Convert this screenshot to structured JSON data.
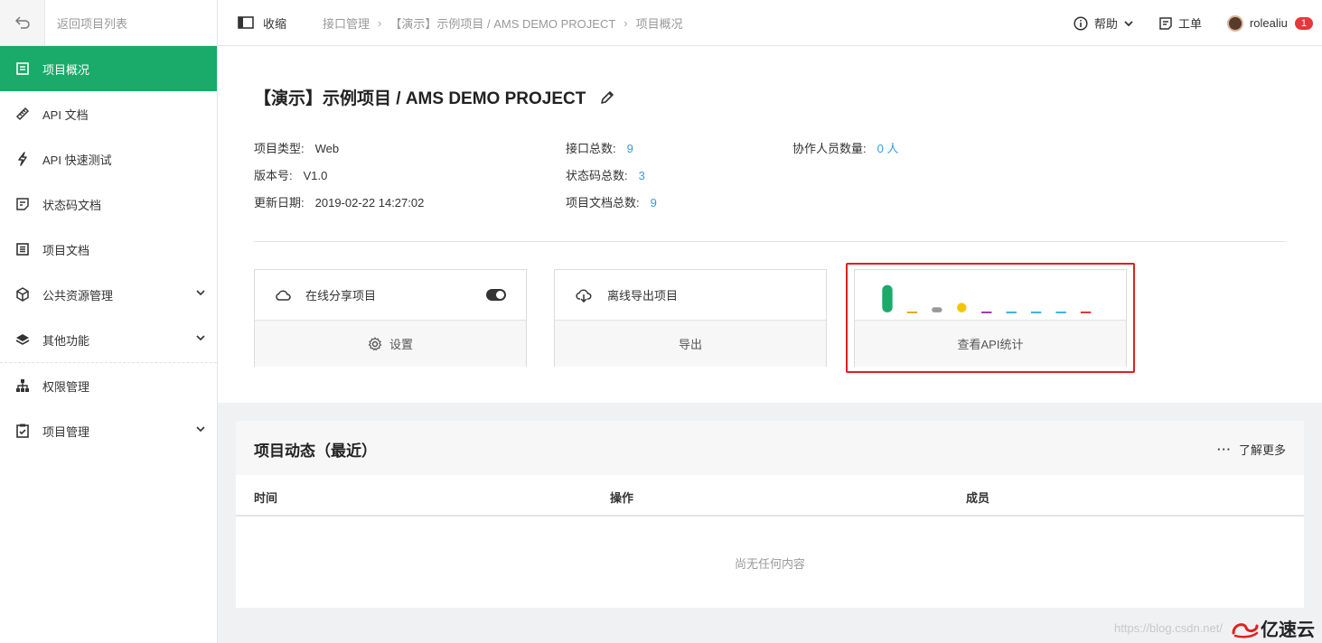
{
  "sidebar": {
    "back_label": "返回项目列表",
    "items": [
      {
        "label": "项目概况",
        "icon": "overview-icon",
        "active": true
      },
      {
        "label": "API 文档",
        "icon": "ruler-icon"
      },
      {
        "label": "API 快速测试",
        "icon": "lightning-icon"
      },
      {
        "label": "状态码文档",
        "icon": "code-doc-icon"
      },
      {
        "label": "项目文档",
        "icon": "document-icon"
      },
      {
        "label": "公共资源管理",
        "icon": "cube-icon",
        "expandable": true
      },
      {
        "label": "其他功能",
        "icon": "layers-icon",
        "expandable": true
      },
      {
        "label": "权限管理",
        "icon": "hierarchy-icon"
      },
      {
        "label": "项目管理",
        "icon": "clipboard-check-icon",
        "expandable": true
      }
    ]
  },
  "topbar": {
    "collapse_label": "收缩",
    "breadcrumb": [
      "接口管理",
      "【演示】示例项目 / AMS DEMO PROJECT",
      "项目概况"
    ],
    "help_label": "帮助",
    "ticket_label": "工单",
    "user_name": "rolealiu",
    "notification_count": "1"
  },
  "project": {
    "title": "【演示】示例项目 / AMS DEMO PROJECT",
    "type_label": "项目类型:",
    "type_value": "Web",
    "version_label": "版本号:",
    "version_value": "V1.0",
    "updated_label": "更新日期:",
    "updated_value": "2019-02-22 14:27:02",
    "api_total_label": "接口总数:",
    "api_total_value": "9",
    "status_total_label": "状态码总数:",
    "status_total_value": "3",
    "doc_total_label": "项目文档总数:",
    "doc_total_value": "9",
    "members_label": "协作人员数量:",
    "members_value": "0 人"
  },
  "cards": {
    "share_label": "在线分享项目",
    "share_enabled": true,
    "settings_label": "设置",
    "export_title": "离线导出项目",
    "export_label": "导出",
    "stats_label": "查看API统计",
    "stats_bars": [
      {
        "value": 1.0,
        "color": "#1aaa69"
      },
      {
        "value": 0.0,
        "color": "#e8a317"
      },
      {
        "value": 0.15,
        "color": "#999999"
      },
      {
        "value": 0.35,
        "color": "#f5c400"
      },
      {
        "value": 0.0,
        "color": "#9b2fa8"
      },
      {
        "value": 0.0,
        "color": "#2fb3d9"
      },
      {
        "value": 0.0,
        "color": "#2fb3d9"
      },
      {
        "value": 0.0,
        "color": "#2fb3d9"
      },
      {
        "value": 0.0,
        "color": "#d9302f"
      }
    ]
  },
  "activity": {
    "title": "项目动态（最近）",
    "more_label": "了解更多",
    "columns": [
      "时间",
      "操作",
      "成员"
    ],
    "empty_text": "尚无任何内容"
  },
  "watermark": {
    "url": "https://blog.csdn.net/",
    "brand": "亿速云"
  }
}
